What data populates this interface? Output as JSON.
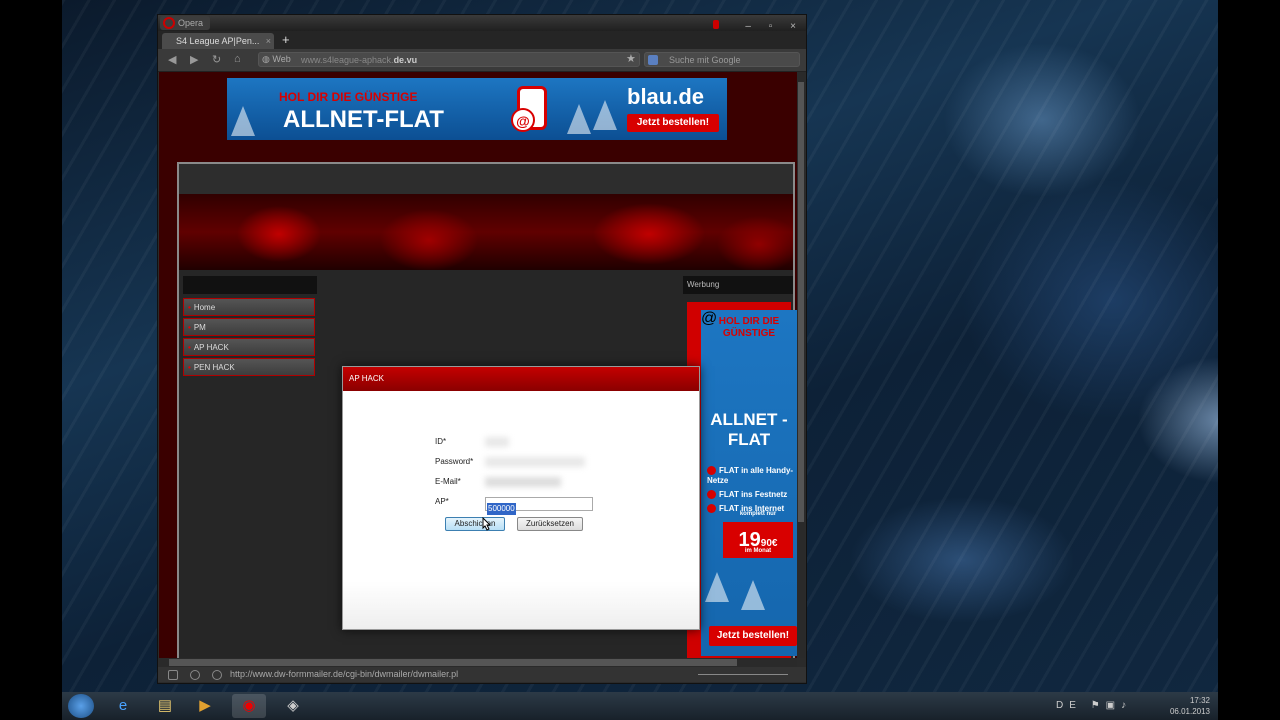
{
  "browser": {
    "app_name": "Opera",
    "tab_title": "S4 League AP|Pen...",
    "tab_close": "×",
    "new_tab": "+",
    "web_badge": "Web",
    "url_prefix": "www.s4league-aphack.",
    "url_domain": "de.vu",
    "search_placeholder": "Suche mit Google",
    "status_url": "http://www.dw-formmailer.de/cgi-bin/dwmailer/dwmailer.pl"
  },
  "banner": {
    "tagline": "HOL DIR DIE GÜNSTIGE",
    "headline": "ALLNET-FLAT",
    "brand": "blau.de",
    "cta": "Jetzt bestellen!"
  },
  "sidebar": {
    "items": [
      {
        "label": "Home"
      },
      {
        "label": "PM"
      },
      {
        "label": "AP HACK"
      },
      {
        "label": "PEN HACK"
      }
    ]
  },
  "ad": {
    "header": "Werbung",
    "tagline": "HOL DIR DIE GÜNSTIGE",
    "headline": "ALLNET -FLAT",
    "features": [
      "FLAT in alle Handy-Netze",
      "FLAT ins Festnetz",
      "FLAT ins Internet"
    ],
    "price_note": "komplett nur",
    "price": "19",
    "price_cents": "90€",
    "price_period": "im Monat",
    "cta": "Jetzt bestellen!"
  },
  "dialog": {
    "title": "AP HACK",
    "fields": [
      {
        "label": "ID*"
      },
      {
        "label": "Password*"
      },
      {
        "label": "E-Mail*"
      },
      {
        "label": "AP*"
      }
    ],
    "ap_value": "500000",
    "submit_label": "Abschicken",
    "reset_label": "Zurücksetzen"
  },
  "taskbar": {
    "language": "DE",
    "time": "17:32",
    "date": "06.01.2013"
  },
  "colors": {
    "accent_red": "#c40000",
    "ad_blue": "#1d76c2"
  }
}
